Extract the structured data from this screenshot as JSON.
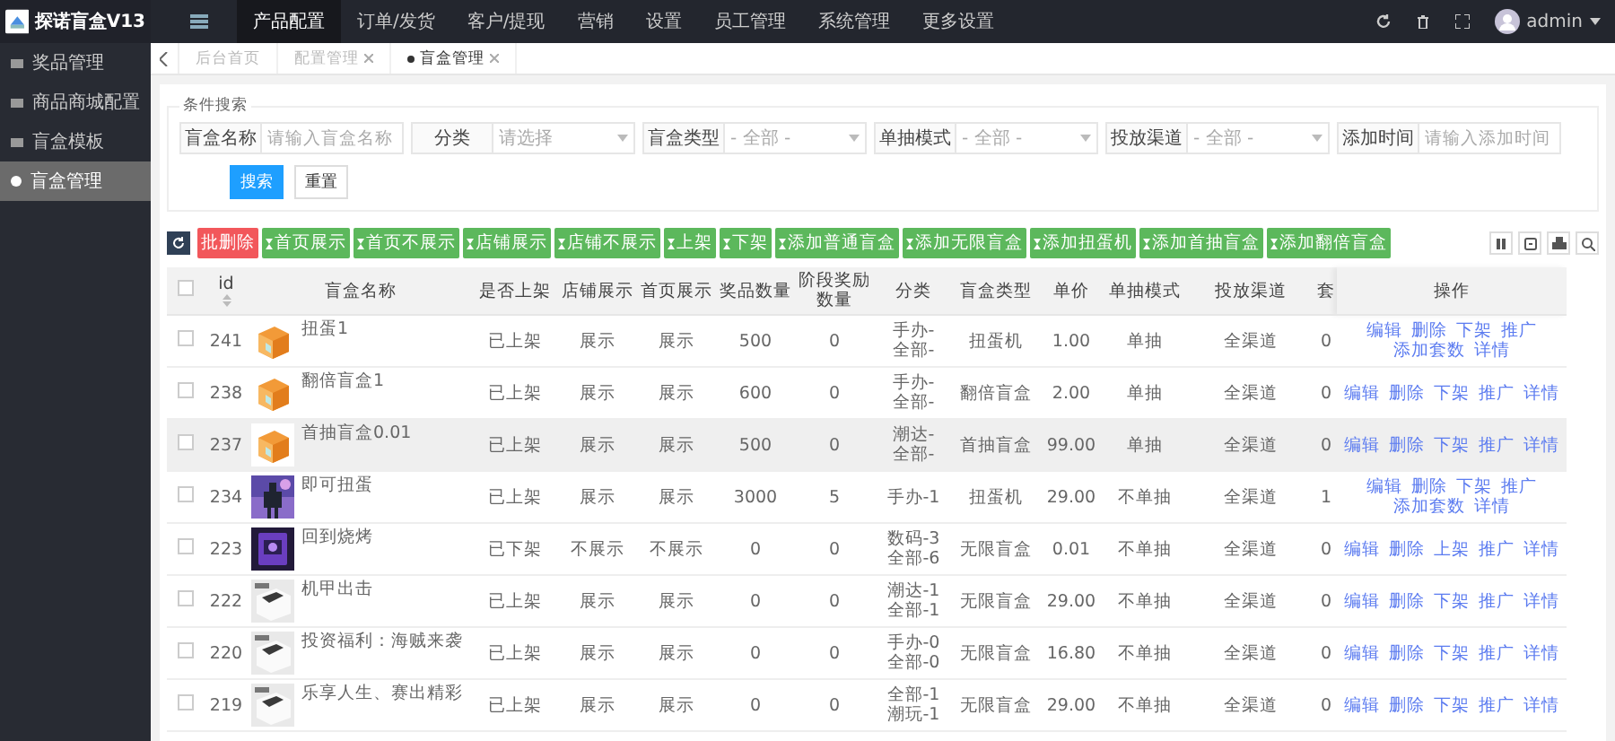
{
  "app": {
    "title": "探诺盲盒V13"
  },
  "top_nav": [
    {
      "label": "产品配置",
      "selected": true
    },
    {
      "label": "订单/发货",
      "selected": false
    },
    {
      "label": "客户/提现",
      "selected": false
    },
    {
      "label": "营销",
      "selected": false
    },
    {
      "label": "设置",
      "selected": false
    },
    {
      "label": "员工管理",
      "selected": false
    },
    {
      "label": "系统管理",
      "selected": false
    },
    {
      "label": "更多设置",
      "selected": false
    }
  ],
  "user": {
    "name": "admin"
  },
  "sidebar": {
    "items": [
      {
        "label": "奖品管理",
        "selected": false
      },
      {
        "label": "商品商城配置",
        "selected": false
      },
      {
        "label": "盲盒模板",
        "selected": false
      },
      {
        "label": "盲盒管理",
        "selected": true
      }
    ]
  },
  "page_tabs": [
    {
      "label": "后台首页",
      "selected": false,
      "closable": false
    },
    {
      "label": "配置管理",
      "selected": false,
      "closable": true
    },
    {
      "label": "盲盒管理",
      "selected": true,
      "closable": true
    }
  ],
  "search": {
    "legend": "条件搜索",
    "fields": [
      {
        "label": "盲盒名称",
        "kind": "input",
        "placeholder": "请输入盲盒名称"
      },
      {
        "label": "分类",
        "kind": "select",
        "placeholder": "请选择"
      },
      {
        "label": "盲盒类型",
        "kind": "select",
        "placeholder": "- 全部 -"
      },
      {
        "label": "单抽模式",
        "kind": "select",
        "placeholder": "- 全部 -"
      },
      {
        "label": "投放渠道",
        "kind": "select",
        "placeholder": "- 全部 -"
      },
      {
        "label": "添加时间",
        "kind": "input",
        "placeholder": "请输入添加时间"
      }
    ],
    "buttons": [
      {
        "label": "搜索",
        "kind": "primary"
      },
      {
        "label": "重置",
        "kind": "default"
      }
    ]
  },
  "toolbar": {
    "buttons": [
      {
        "label": "批删除",
        "kind": "danger"
      },
      {
        "label": "首页展示",
        "kind": "success"
      },
      {
        "label": "首页不展示",
        "kind": "success"
      },
      {
        "label": "店铺展示",
        "kind": "success"
      },
      {
        "label": "店铺不展示",
        "kind": "success"
      },
      {
        "label": "上架",
        "kind": "success"
      },
      {
        "label": "下架",
        "kind": "success"
      },
      {
        "label": "添加普通盲盒",
        "kind": "success"
      },
      {
        "label": "添加无限盲盒",
        "kind": "success"
      },
      {
        "label": "添加扭蛋机",
        "kind": "success"
      },
      {
        "label": "添加首抽盲盒",
        "kind": "success"
      },
      {
        "label": "添加翻倍盲盒",
        "kind": "success"
      }
    ]
  },
  "table": {
    "header_checked": false,
    "columns": [
      "id",
      "盲盒名称",
      "是否上架",
      "店铺展示",
      "首页展示",
      "奖品数量",
      "阶段奖励数量",
      "分类",
      "盲盒类型",
      "单价",
      "单抽模式",
      "投放渠道",
      "套",
      "操作"
    ],
    "rows": [
      {
        "checked": false,
        "selected": false,
        "id": "241",
        "name": "扭蛋1",
        "on_shelf": "已上架",
        "shop_display": "展示",
        "home_display": "展示",
        "prize_count": "500",
        "stage_reward_count": "0",
        "category": "手办-\n全部-",
        "box_type": "扭蛋机",
        "price": "1.00",
        "draw_mode": "单抽",
        "channel": "全渠道",
        "column_13": "0",
        "actions": [
          "编辑",
          "删除",
          "下架",
          "推广",
          "添加套数",
          "详情"
        ]
      },
      {
        "checked": false,
        "selected": false,
        "id": "238",
        "name": "翻倍盲盒1",
        "on_shelf": "已上架",
        "shop_display": "展示",
        "home_display": "展示",
        "prize_count": "600",
        "stage_reward_count": "0",
        "category": "手办-\n全部-",
        "box_type": "翻倍盲盒",
        "price": "2.00",
        "draw_mode": "单抽",
        "channel": "全渠道",
        "column_13": "0",
        "actions": [
          "编辑",
          "删除",
          "下架",
          "推广",
          "详情"
        ]
      },
      {
        "checked": false,
        "selected": true,
        "id": "237",
        "name": "首抽盲盒0.01",
        "on_shelf": "已上架",
        "shop_display": "展示",
        "home_display": "展示",
        "prize_count": "500",
        "stage_reward_count": "0",
        "category": "潮达-\n全部-",
        "box_type": "首抽盲盒",
        "price": "99.00",
        "draw_mode": "单抽",
        "channel": "全渠道",
        "column_13": "0",
        "actions": [
          "编辑",
          "删除",
          "下架",
          "推广",
          "详情"
        ]
      },
      {
        "checked": false,
        "selected": false,
        "id": "234",
        "name": "即可扭蛋",
        "on_shelf": "已上架",
        "shop_display": "展示",
        "home_display": "展示",
        "prize_count": "3000",
        "stage_reward_count": "5",
        "category": "手办-1",
        "box_type": "扭蛋机",
        "price": "29.00",
        "draw_mode": "不单抽",
        "channel": "全渠道",
        "column_13": "1",
        "actions": [
          "编辑",
          "删除",
          "下架",
          "推广",
          "添加套数",
          "详情"
        ]
      },
      {
        "checked": false,
        "selected": false,
        "id": "223",
        "name": "回到烧烤",
        "on_shelf": "已下架",
        "shop_display": "不展示",
        "home_display": "不展示",
        "prize_count": "0",
        "stage_reward_count": "0",
        "category": "数码-3\n全部-6",
        "box_type": "无限盲盒",
        "price": "0.01",
        "draw_mode": "不单抽",
        "channel": "全渠道",
        "column_13": "0",
        "actions": [
          "编辑",
          "删除",
          "上架",
          "推广",
          "详情"
        ]
      },
      {
        "checked": false,
        "selected": false,
        "id": "222",
        "name": "机甲出击",
        "on_shelf": "已上架",
        "shop_display": "展示",
        "home_display": "展示",
        "prize_count": "0",
        "stage_reward_count": "0",
        "category": "潮达-1\n全部-1",
        "box_type": "无限盲盒",
        "price": "29.00",
        "draw_mode": "不单抽",
        "channel": "全渠道",
        "column_13": "0",
        "actions": [
          "编辑",
          "删除",
          "下架",
          "推广",
          "详情"
        ]
      },
      {
        "checked": false,
        "selected": false,
        "id": "220",
        "name": "投资福利：海贼来袭",
        "on_shelf": "已上架",
        "shop_display": "展示",
        "home_display": "展示",
        "prize_count": "0",
        "stage_reward_count": "0",
        "category": "手办-0\n全部-0",
        "box_type": "无限盲盒",
        "price": "16.80",
        "draw_mode": "不单抽",
        "channel": "全渠道",
        "column_13": "0",
        "actions": [
          "编辑",
          "删除",
          "下架",
          "推广",
          "详情"
        ]
      },
      {
        "checked": false,
        "selected": false,
        "id": "219",
        "name": "乐享人生、赛出精彩",
        "on_shelf": "已上架",
        "shop_display": "展示",
        "home_display": "展示",
        "prize_count": "0",
        "stage_reward_count": "0",
        "category": "全部-1\n潮玩-1",
        "box_type": "无限盲盒",
        "price": "29.00",
        "draw_mode": "不单抽",
        "channel": "全渠道",
        "column_13": "0",
        "actions": [
          "编辑",
          "删除",
          "下架",
          "推广",
          "详情"
        ]
      }
    ]
  }
}
